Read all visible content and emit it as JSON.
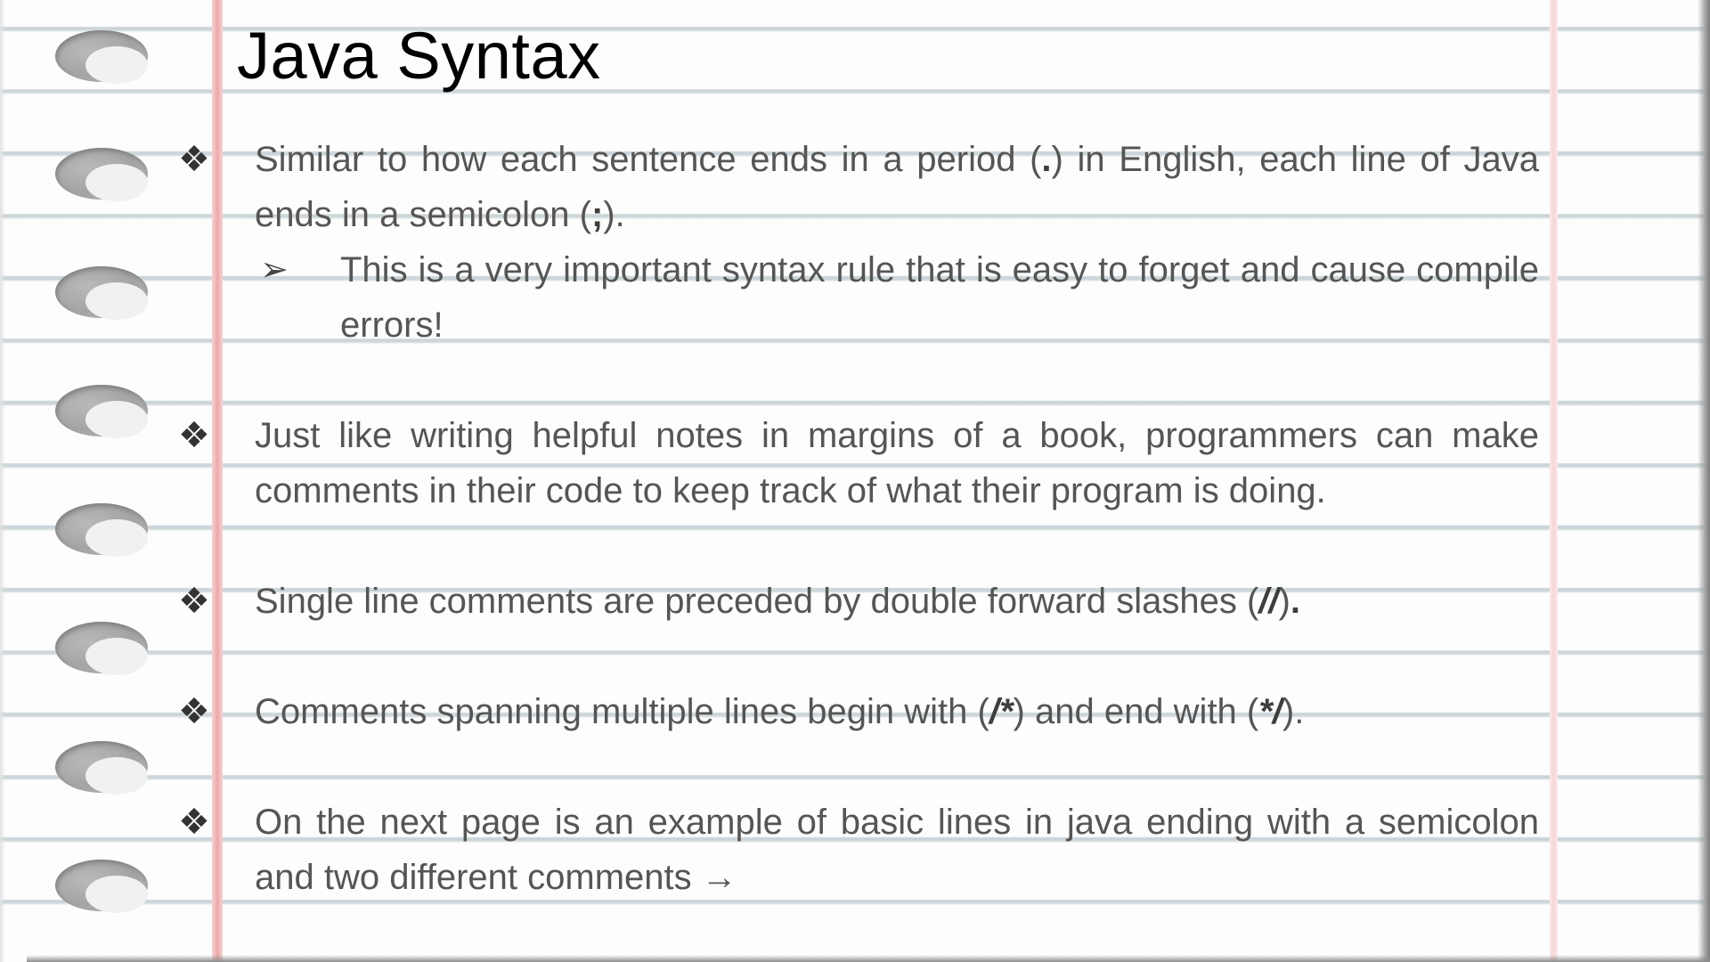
{
  "slide": {
    "title": "Java Syntax",
    "bullet_symbol": "❖",
    "sub_bullet_symbol": "➢",
    "bullets": [
      {
        "parts": [
          "Similar to how each sentence ends in a period (",
          ".",
          ") in English, each line of Java ends in a semicolon (",
          ";",
          ")."
        ],
        "sub": {
          "text": "This is a very important syntax rule that is easy to forget and cause compile errors!"
        }
      },
      {
        "text": "Just like writing helpful notes in margins of a book, programmers can make comments in their code to keep track of what their program is doing."
      },
      {
        "parts": [
          "Single line comments are preceded by double forward slashes (",
          "//",
          ")",
          "."
        ]
      },
      {
        "parts": [
          "Comments spanning multiple lines begin with (",
          "/*",
          ") and end with (",
          "*/",
          ")."
        ]
      },
      {
        "text": "On the next page is an example of basic lines in java ending with a semicolon and two different comments →"
      }
    ]
  },
  "colors": {
    "title": "#000000",
    "body_text": "#555555",
    "margin_line": "#eba9a9",
    "ruled_line": "#d2dade"
  },
  "icons": {
    "bullet": "four-diamond-bullet-icon",
    "sub_bullet": "arrowhead-bullet-icon",
    "binder_hole": "binder-hole-icon"
  }
}
